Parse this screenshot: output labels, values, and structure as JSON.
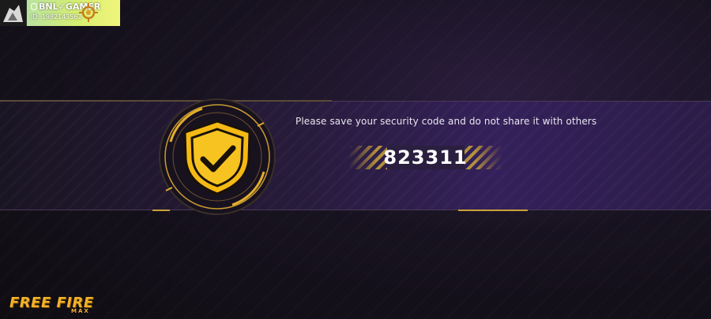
{
  "profile": {
    "name": "BNL✓GAMER",
    "id_text": "ID: 1982143562"
  },
  "security": {
    "message": "Please save your security code and do not share it with others",
    "code": "823311"
  },
  "logo": {
    "title": "FREE FIRE",
    "subtitle": "MAX"
  },
  "colors": {
    "accent": "#f3b22a",
    "shield": "#f5b914",
    "band": "#2b1c48"
  },
  "icons": {
    "shield": "shield-check-icon",
    "avatar": "avatar-icon",
    "emblem": "rank-emblem-icon"
  }
}
